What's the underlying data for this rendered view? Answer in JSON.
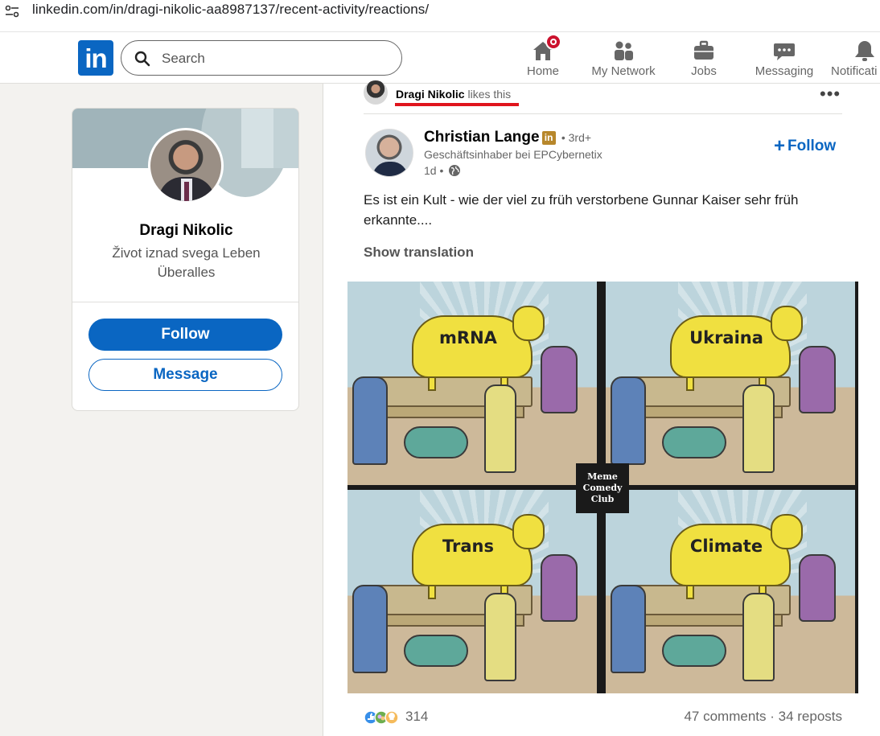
{
  "browser": {
    "url": "linkedin.com/in/dragi-nikolic-aa8987137/recent-activity/reactions/"
  },
  "header": {
    "logo_text": "in",
    "search_placeholder": "Search",
    "nav": [
      {
        "label": "Home",
        "icon": "home-icon",
        "has_badge": true
      },
      {
        "label": "My Network",
        "icon": "network-icon"
      },
      {
        "label": "Jobs",
        "icon": "jobs-icon"
      },
      {
        "label": "Messaging",
        "icon": "messaging-icon"
      },
      {
        "label": "Notificati",
        "icon": "bell-icon"
      }
    ]
  },
  "profile_card": {
    "name": "Dragi Nikolic",
    "headline": "Život iznad svega Leben Überalles",
    "follow_label": "Follow",
    "message_label": "Message"
  },
  "activity": {
    "reactor_name": "Dragi Nikolic",
    "reaction_text": "likes this",
    "more_label": "•••"
  },
  "post": {
    "author_name": "Christian Lange",
    "author_badge": "in",
    "degree": "• 3rd+",
    "author_headline": "Geschäftsinhaber bei EPCybernetix",
    "time": "1d •",
    "follow_label": "Follow",
    "text": "Es ist ein Kult - wie der viel zu früh verstorbene Gunnar Kaiser sehr früh erkannte....",
    "show_translation": "Show translation",
    "image": {
      "panels": [
        "mRNA",
        "Ukraina",
        "Trans",
        "Climate"
      ],
      "badge_lines": [
        "Meme",
        "Comedy",
        "Club"
      ]
    },
    "reactions_count": "314",
    "comments_reposts": "47 comments · 34 reposts"
  },
  "colors": {
    "brand": "#0a66c2",
    "badge_red": "#cb112d",
    "underline_red": "#e0141c",
    "premium_badge": "#b7872b"
  }
}
